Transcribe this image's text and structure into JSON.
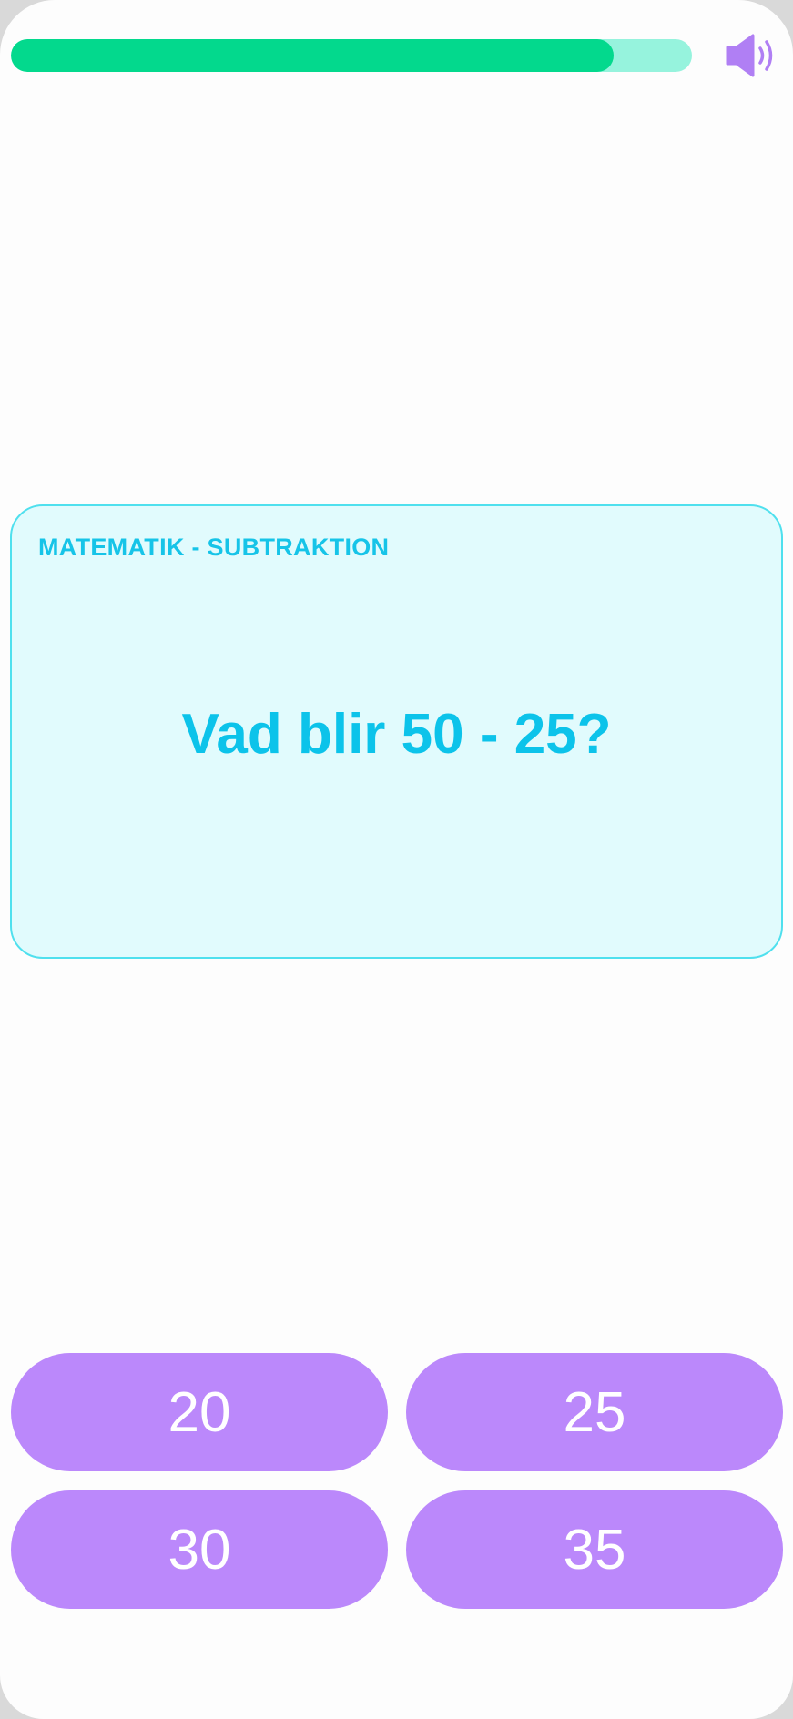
{
  "progress": {
    "fraction": 0.885
  },
  "colors": {
    "progress_fill": "#03d98d",
    "progress_track": "#96f3dd",
    "accent_cyan": "#0cc3ea",
    "card_background": "#e1fbfd",
    "answer_button": "#bb88fb",
    "sound_icon": "#b07ff4"
  },
  "sound": {
    "icon": "speaker-icon"
  },
  "question": {
    "subject": "MATEMATIK - SUBTRAKTION",
    "text": "Vad blir 50 - 25?"
  },
  "answers": [
    "20",
    "25",
    "30",
    "35"
  ]
}
